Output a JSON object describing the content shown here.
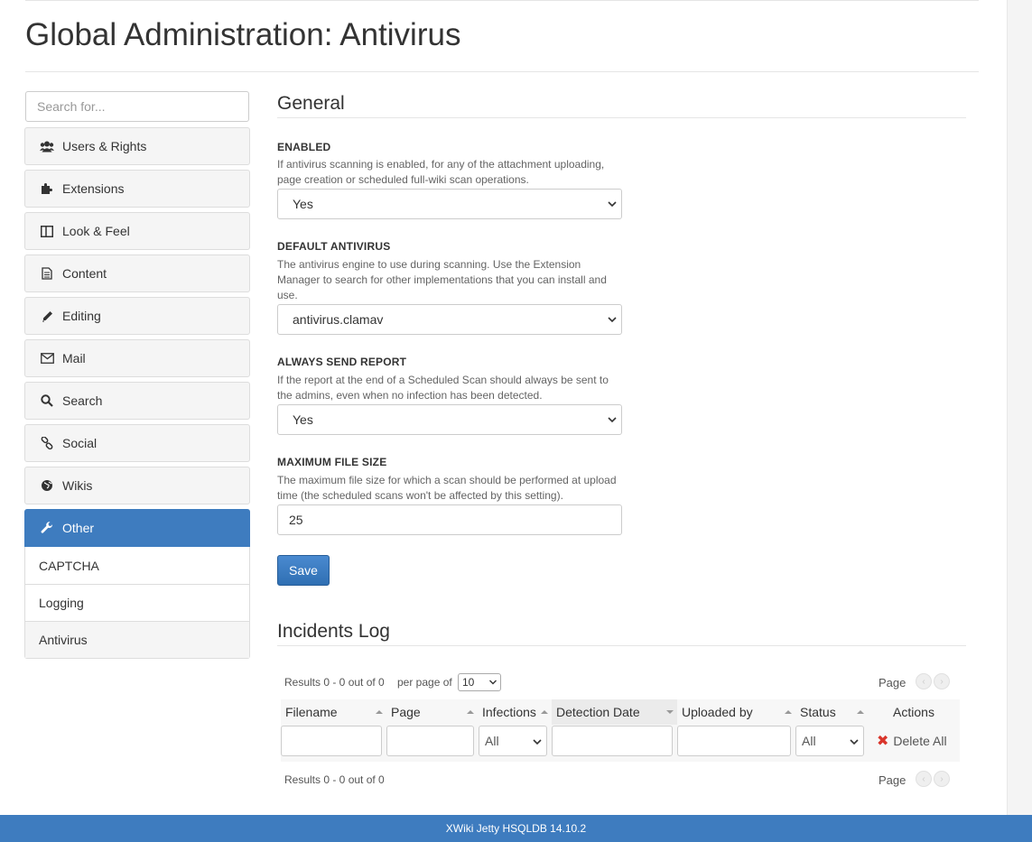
{
  "page": {
    "title": "Global Administration: Antivirus"
  },
  "sidebar": {
    "search_placeholder": "Search for...",
    "items": [
      {
        "label": "Users & Rights",
        "icon": "users-icon"
      },
      {
        "label": "Extensions",
        "icon": "puzzle-icon"
      },
      {
        "label": "Look & Feel",
        "icon": "columns-icon"
      },
      {
        "label": "Content",
        "icon": "document-icon"
      },
      {
        "label": "Editing",
        "icon": "pencil-icon"
      },
      {
        "label": "Mail",
        "icon": "envelope-icon"
      },
      {
        "label": "Search",
        "icon": "search-icon"
      },
      {
        "label": "Social",
        "icon": "link-icon"
      },
      {
        "label": "Wikis",
        "icon": "globe-icon"
      },
      {
        "label": "Other",
        "icon": "wrench-icon",
        "active": true
      }
    ],
    "sub_items": [
      {
        "label": "CAPTCHA"
      },
      {
        "label": "Logging"
      },
      {
        "label": "Antivirus",
        "selected": true
      }
    ],
    "active_color": "#3e7cbf"
  },
  "general": {
    "title": "General",
    "enabled": {
      "label": "ENABLED",
      "help": "If antivirus scanning is enabled, for any of the attachment uploading, page creation or scheduled full-wiki scan operations.",
      "value": "Yes"
    },
    "default_antivirus": {
      "label": "DEFAULT ANTIVIRUS",
      "help": "The antivirus engine to use during scanning. Use the Extension Manager to search for other implementations that you can install and use.",
      "value": "antivirus.clamav"
    },
    "always_send_report": {
      "label": "ALWAYS SEND REPORT",
      "help": "If the report at the end of a Scheduled Scan should always be sent to the admins, even when no infection has been detected.",
      "value": "Yes"
    },
    "max_file_size": {
      "label": "MAXIMUM FILE SIZE",
      "help": "The maximum file size for which a scan should be performed at upload time (the scheduled scans won't be affected by this setting).",
      "value": "25"
    },
    "save_label": "Save"
  },
  "incidents": {
    "title": "Incidents Log",
    "results_top": "Results 0 - 0 out of 0",
    "per_page_label": "per page of",
    "per_page_value": "10",
    "page_label": "Page",
    "results_bottom": "Results 0 - 0 out of 0",
    "columns": [
      "Filename",
      "Page",
      "Infections",
      "Detection Date",
      "Uploaded by",
      "Status",
      "Actions"
    ],
    "infections_filter": "All",
    "status_filter": "All",
    "delete_all": "Delete All"
  },
  "footer": {
    "text": "XWiki Jetty HSQLDB 14.10.2"
  }
}
